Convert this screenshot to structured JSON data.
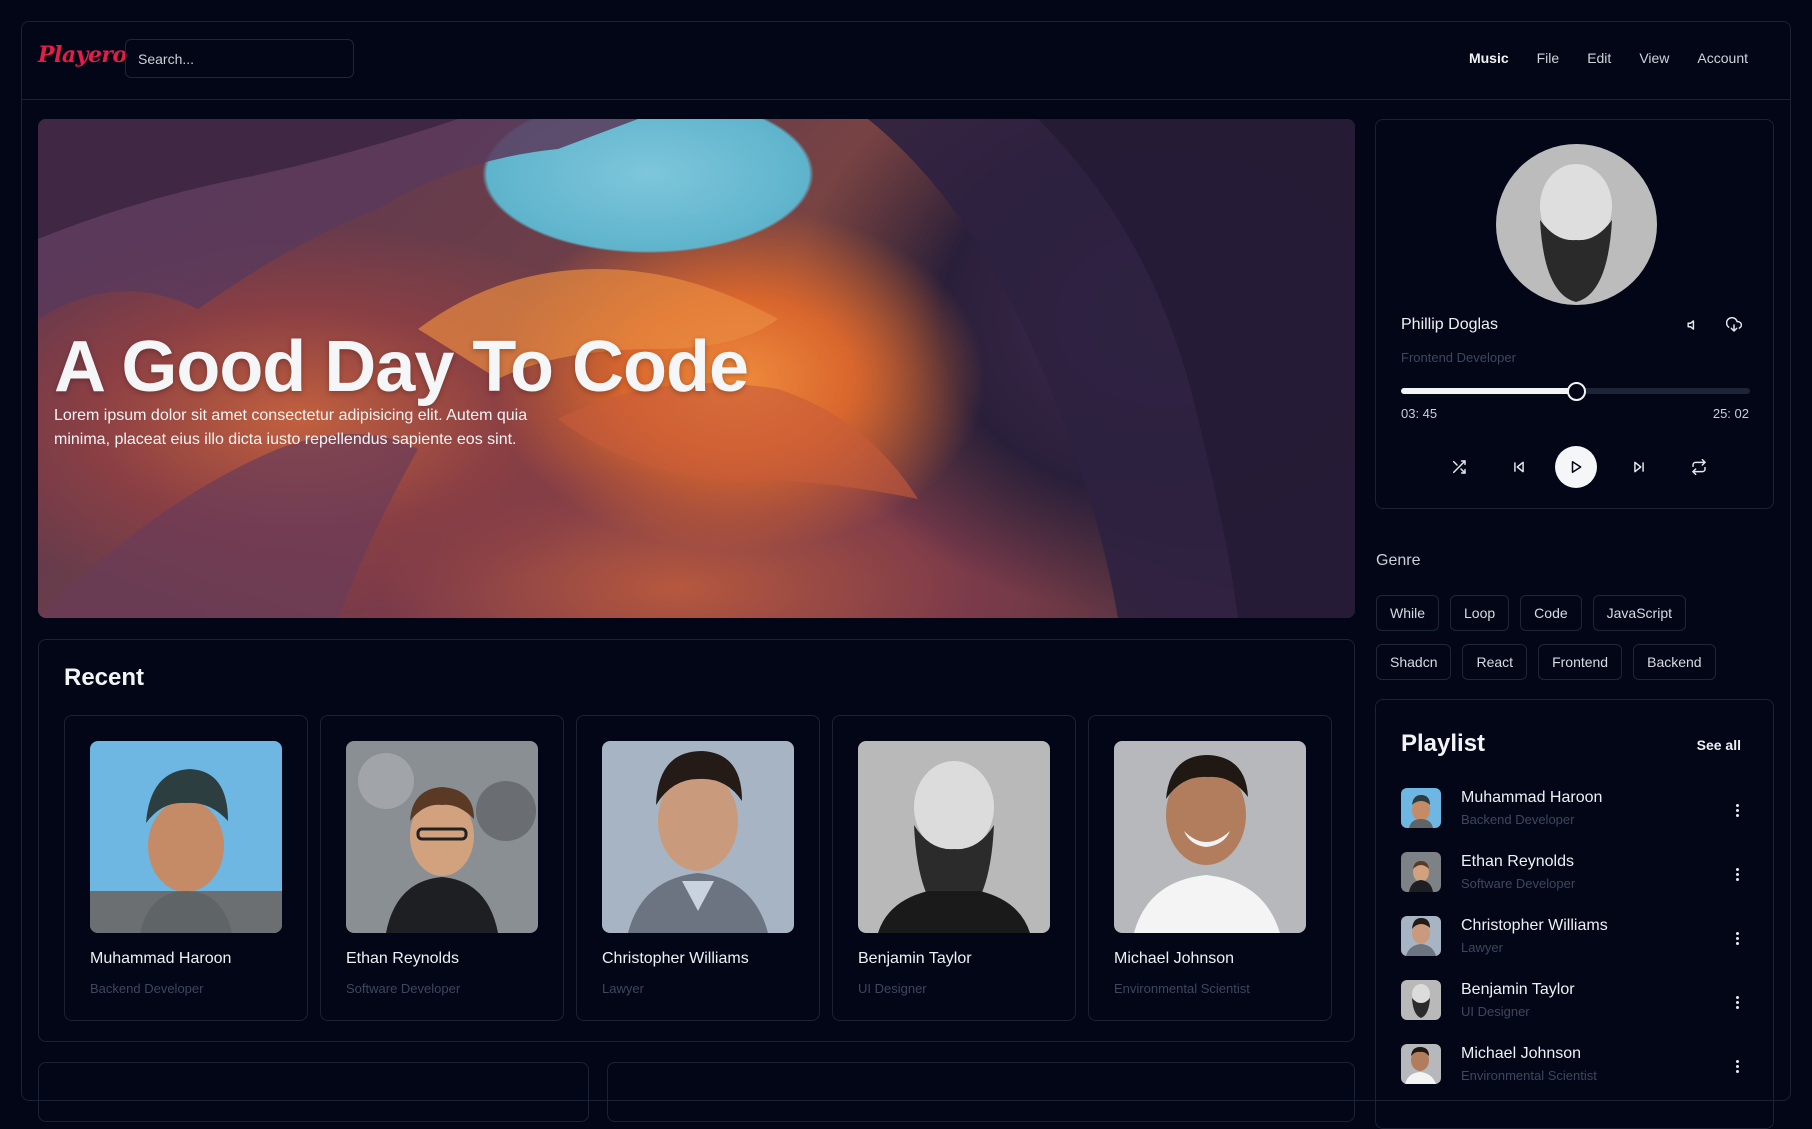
{
  "app": {
    "logo": "Playero"
  },
  "search": {
    "placeholder": "Search..."
  },
  "menu": [
    {
      "label": "Music",
      "active": true
    },
    {
      "label": "File"
    },
    {
      "label": "Edit"
    },
    {
      "label": "View"
    },
    {
      "label": "Account"
    }
  ],
  "hero": {
    "title": "A Good Day To Code",
    "description": "Lorem ipsum dolor sit amet consectetur adipisicing elit. Autem quia minima, placeat eius illo dicta iusto repellendus sapiente eos sint."
  },
  "recent": {
    "title": "Recent",
    "items": [
      {
        "name": "Muhammad Haroon",
        "role": "Backend Developer"
      },
      {
        "name": "Ethan Reynolds",
        "role": "Software Developer"
      },
      {
        "name": "Christopher Williams",
        "role": "Lawyer"
      },
      {
        "name": "Benjamin Taylor",
        "role": "UI Designer"
      },
      {
        "name": "Michael Johnson",
        "role": "Environmental Scientist"
      }
    ]
  },
  "player": {
    "name": "Phillip Doglas",
    "role": "Frontend Developer",
    "current_time": "03: 45",
    "total_time": "25: 02",
    "progress": 0.5,
    "icons": [
      "volume-icon",
      "download-cloud-icon",
      "shuffle-icon",
      "skip-back-icon",
      "play-icon",
      "skip-forward-icon",
      "repeat-icon"
    ]
  },
  "genre": {
    "title": "Genre",
    "rows": [
      [
        "While",
        "Loop",
        "Code",
        "JavaScript"
      ],
      [
        "Shadcn",
        "React",
        "Frontend",
        "Backend"
      ]
    ]
  },
  "playlist": {
    "title": "Playlist",
    "see_all": "See all",
    "items": [
      {
        "name": "Muhammad Haroon",
        "role": "Backend Developer"
      },
      {
        "name": "Ethan Reynolds",
        "role": "Software Developer"
      },
      {
        "name": "Christopher Williams",
        "role": "Lawyer"
      },
      {
        "name": "Benjamin Taylor",
        "role": "UI Designer"
      },
      {
        "name": "Michael Johnson",
        "role": "Environmental Scientist"
      }
    ]
  },
  "colors": {
    "background": "#030616",
    "border": "#1b2235",
    "brand": "#e11d48",
    "muted": "#3e4660"
  }
}
